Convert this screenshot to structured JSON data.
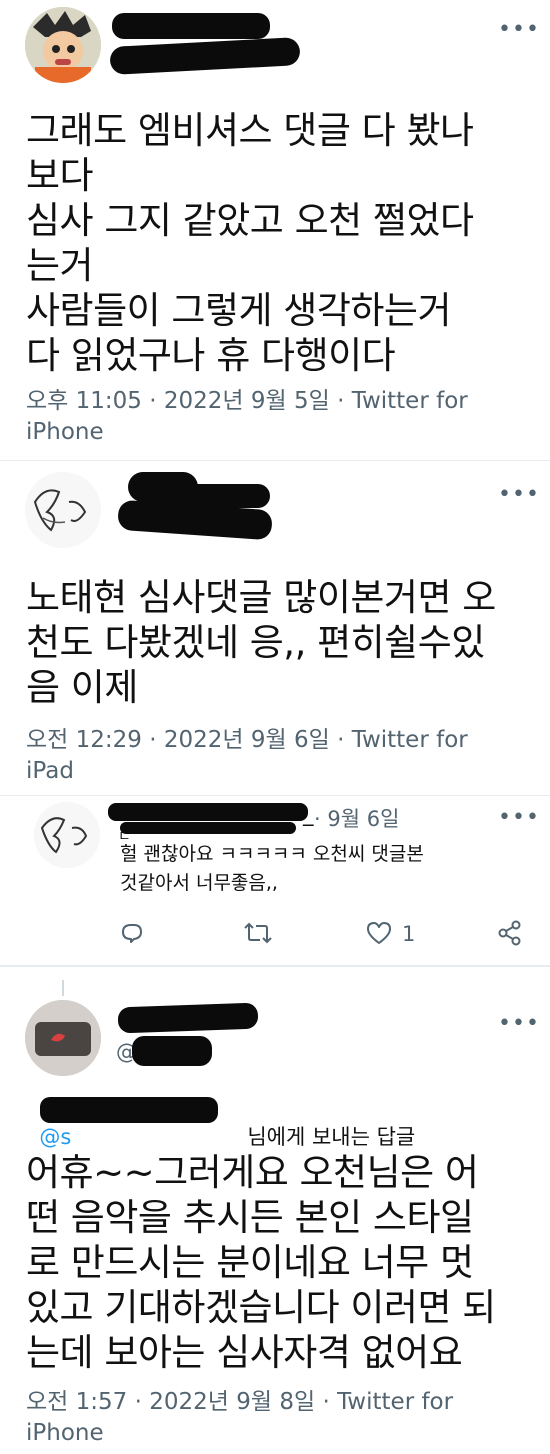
{
  "tweet1": {
    "text": "그래도 엠비셔스 댓글 다 봤나\n보다\n심사 그지 같았고 오천 쩔었다\n는거\n사람들이 그렇게 생각하는거\n다 읽었구나 휴 다행이다",
    "time": "오후 11:05",
    "date": "2022년 9월 5일",
    "source": "Twitter for\niPhone",
    "separator": "·"
  },
  "tweet2": {
    "text": "노태현 심사댓글 많이본거면 오\n천도 다봤겠네 응,, 편히쉴수있\n음 이제",
    "time": "오전 12:29",
    "date": "2022년 9월 6일",
    "source": "Twitter for\niPad",
    "separator": "·"
  },
  "reply": {
    "date": "· 9월 6일",
    "handle_tail": "_",
    "text": "헐 괜찮아요 ㅋㅋㅋㅋㅋ 오천씨 댓글본\n것같아서 너무좋음,,",
    "like_count": "1"
  },
  "tweet3": {
    "handle_prefix": "@",
    "replying_to_prefix": "@s",
    "replying_to_suffix": "님에게 보내는 답글",
    "text": "어휴~~그러게요 오천님은 어\n떤 음악을 추시든 본인 스타일\n로 만드시는 분이네요 너무 멋\n있고 기대하겠습니다 이러면 되\n는데 보아는 심사자격 없어요",
    "time": "오전 1:57",
    "date": "2022년 9월 8일",
    "source": "Twitter for\niPhone",
    "separator": "·"
  },
  "icons": {
    "more": "more-horizontal-icon",
    "reply": "reply-icon",
    "retweet": "retweet-icon",
    "like": "heart-icon",
    "share": "share-icon"
  },
  "colors": {
    "text": "#0f1419",
    "meta": "#536471",
    "divider": "#e6ecf0",
    "redaction": "#0b0b0b"
  }
}
